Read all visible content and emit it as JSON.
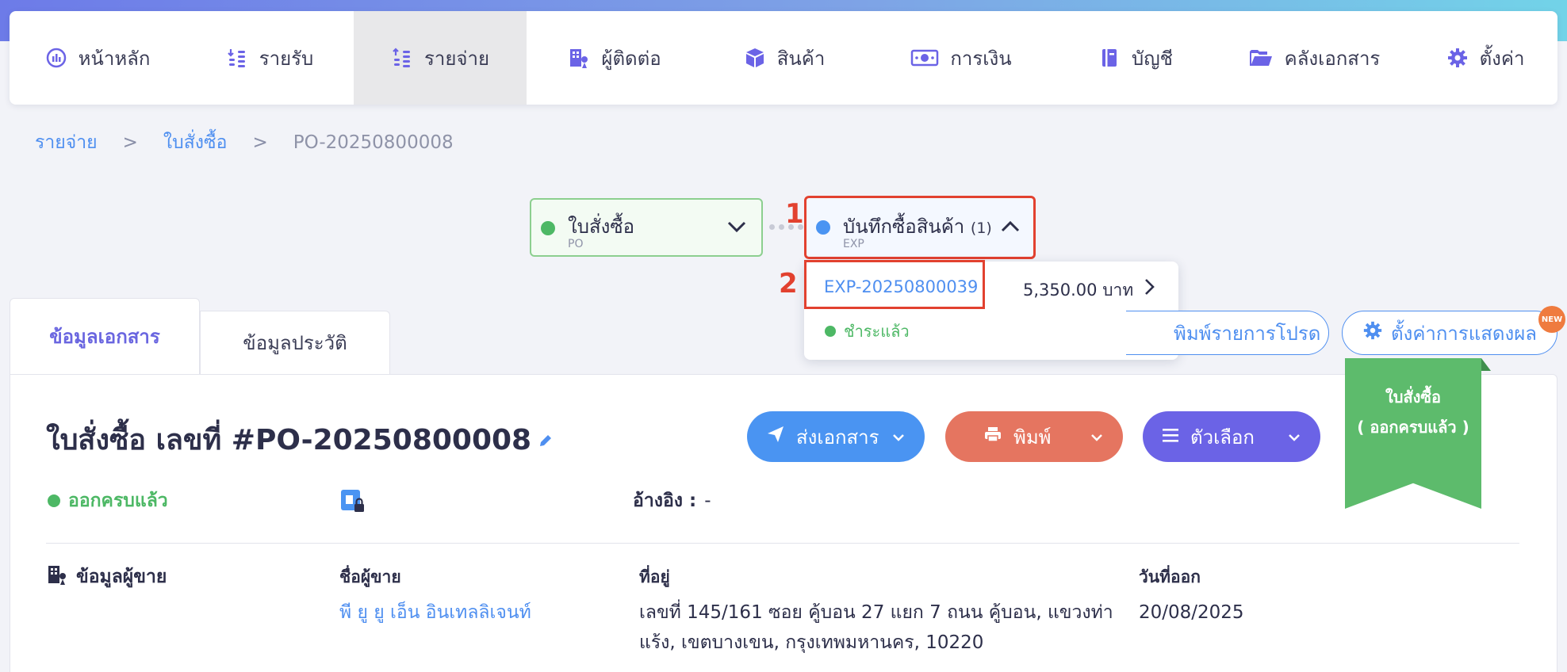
{
  "nav": {
    "items": [
      {
        "label": "หน้าหลัก",
        "icon": "dashboard-icon"
      },
      {
        "label": "รายรับ",
        "icon": "income-icon"
      },
      {
        "label": "รายจ่าย",
        "icon": "expense-icon"
      },
      {
        "label": "ผู้ติดต่อ",
        "icon": "contacts-icon"
      },
      {
        "label": "สินค้า",
        "icon": "box-icon"
      },
      {
        "label": "การเงิน",
        "icon": "money-icon"
      },
      {
        "label": "บัญชี",
        "icon": "ledger-icon"
      },
      {
        "label": "คลังเอกสาร",
        "icon": "folder-icon"
      },
      {
        "label": "ตั้งค่า",
        "icon": "gear-icon"
      }
    ],
    "active_index": 2
  },
  "breadcrumb": {
    "items": [
      "รายจ่าย",
      "ใบสั่งซื้อ"
    ],
    "separator": ">",
    "current": "PO-20250800008"
  },
  "flow": {
    "po": {
      "title": "ใบสั่งซื้อ",
      "sub": "PO"
    },
    "exp": {
      "title": "บันทึกซื้อสินค้า",
      "count": "(1)",
      "sub": "EXP"
    }
  },
  "annotations": {
    "one": "1",
    "two": "2"
  },
  "dropdown": {
    "code": "EXP-20250800039",
    "amount": "5,350.00 บาท",
    "status": "ชำระแล้ว"
  },
  "tabs": {
    "info": "ข้อมูลเอกสาร",
    "history": "ข้อมูลประวัติ"
  },
  "toolbar": {
    "print_list_label": "พิมพ์รายการโปรด",
    "display_settings_label": "ตั้งค่าการแสดงผล",
    "new_badge": "NEW"
  },
  "document": {
    "title": "ใบสั่งซื้อ เลขที่ #PO-20250800008",
    "send_label": "ส่งเอกสาร",
    "print_label": "พิมพ์",
    "options_label": "ตัวเลือก",
    "ribbon_line1": "ใบสั่งซื้อ",
    "ribbon_line2": "( ออกครบแล้ว )",
    "status": "ออกครบแล้ว",
    "reference_label": "อ้างอิง :",
    "reference_value": "-"
  },
  "vendor": {
    "section_title": "ข้อมูลผู้ขาย",
    "name_label": "ชื่อผู้ขาย",
    "name_value": "พี ยู ยู เอ็น อินเทลลิเจนท์",
    "address_label": "ที่อยู่",
    "address_value": "เลขที่ 145/161 ซอย คู้บอน 27 แยก 7 ถนน คู้บอน, แขวงท่าแร้ง, เขตบางเขน, กรุงเทพมหานคร, 10220",
    "date_label": "วันที่ออก",
    "date_value": "20/08/2025"
  },
  "colors": {
    "accent": "#6b63e6",
    "link": "#4f8ff0",
    "success": "#4db865",
    "highlight": "#e2412f"
  }
}
